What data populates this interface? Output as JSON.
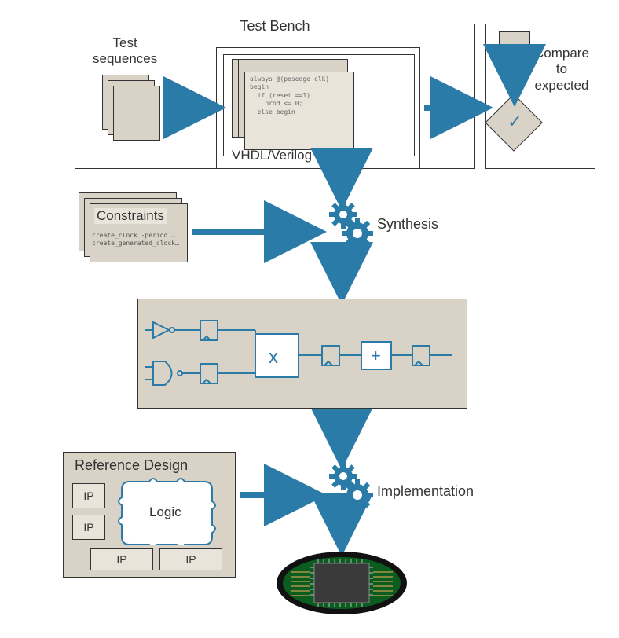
{
  "testbench": {
    "label": "Test Bench",
    "test_sequences_label": "Test\nsequences",
    "rtl_label": "VHDL/Verilog RTL",
    "rtl_code": "always @(posedge clk)\nbegin\n  if (reset ==1)\n    prod <= 0;\n  else begin"
  },
  "compare": {
    "label": "Compare\nto\nexpected"
  },
  "constraints": {
    "label": "Constraints",
    "code": "create_clock -period …\ncreate_generated_clock…"
  },
  "synthesis": {
    "label": "Synthesis"
  },
  "schematic": {
    "multiply_symbol": "x",
    "add_symbol": "+"
  },
  "reference_design": {
    "label": "Reference Design",
    "logic_label": "Logic",
    "ip_label": "IP"
  },
  "implementation": {
    "label": "Implementation"
  }
}
